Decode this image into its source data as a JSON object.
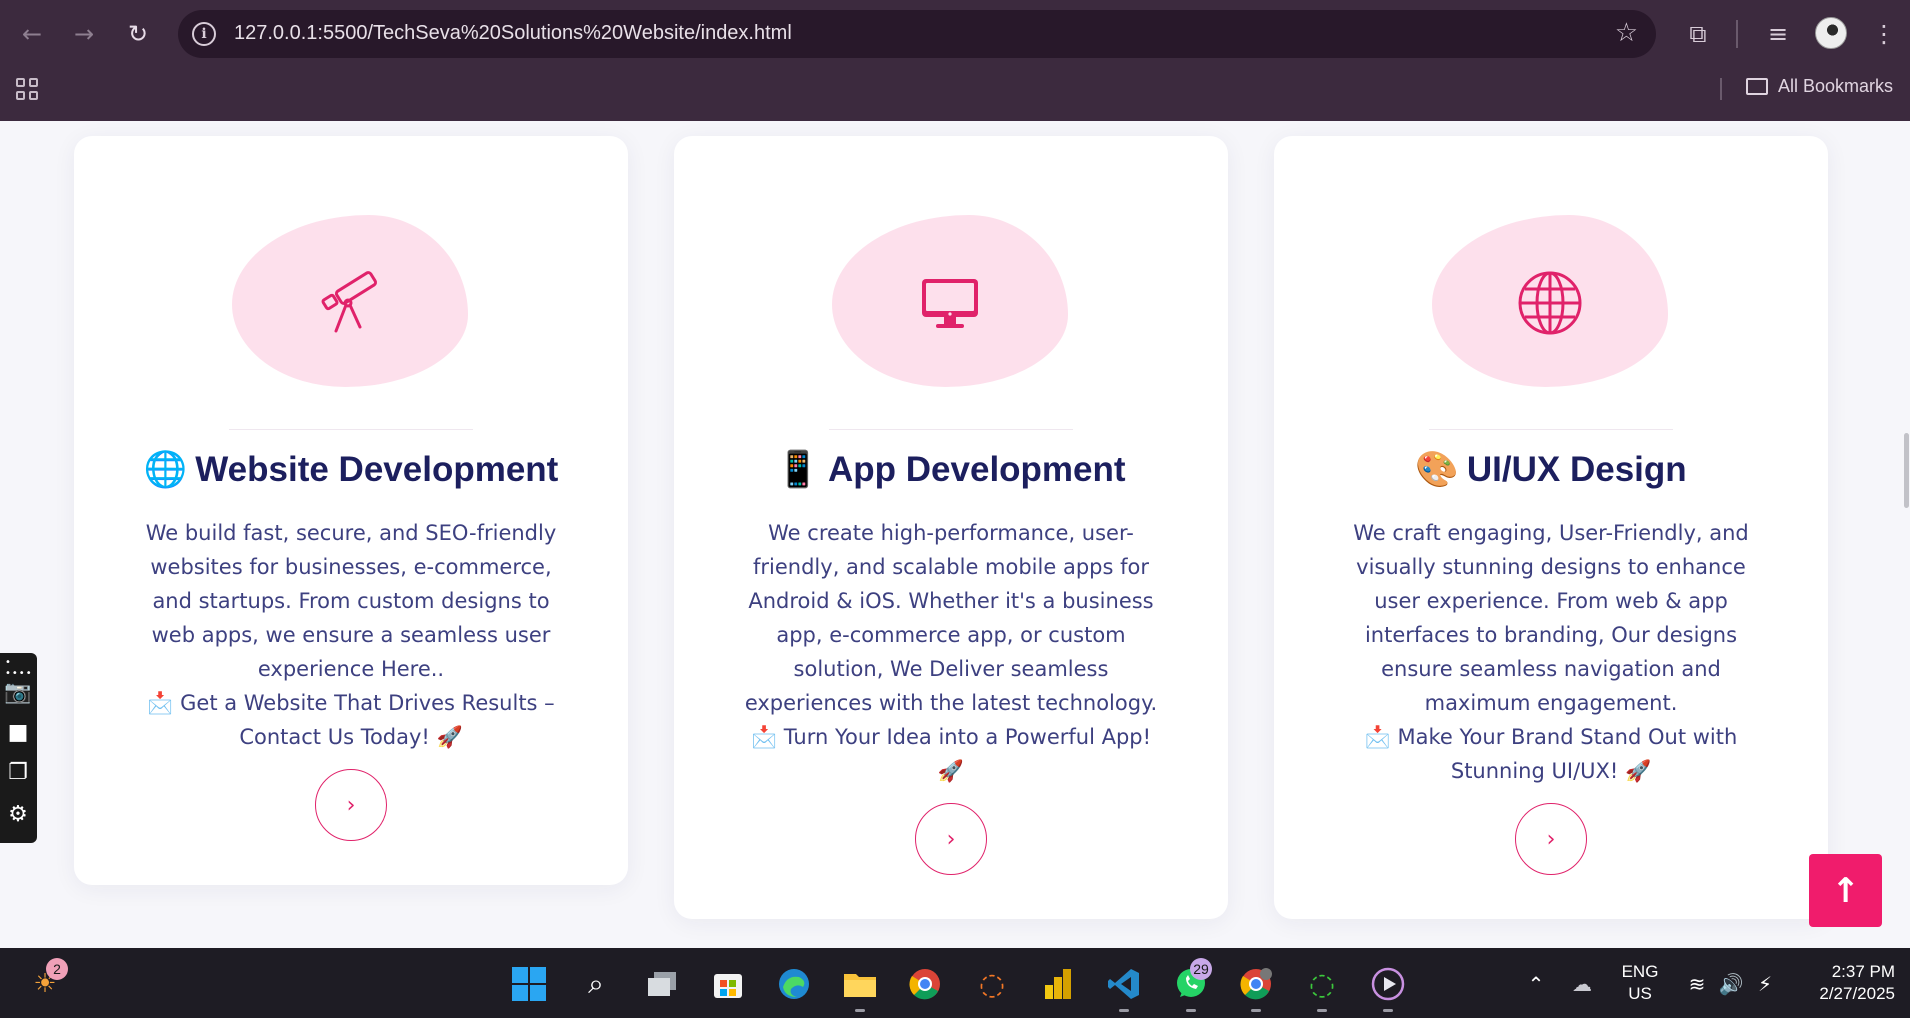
{
  "browser": {
    "url": "127.0.0.1:5500/TechSeva%20Solutions%20Website/index.html",
    "bookmarks_label": "All Bookmarks"
  },
  "cards": [
    {
      "emoji": "🌐",
      "title": "Website Development",
      "icon": "telescope-icon",
      "description": [
        "We build fast, secure, and SEO-friendly",
        "websites for businesses, e-commerce,",
        "and startups. From custom designs to",
        "web apps, we ensure a seamless user",
        "experience Here.."
      ],
      "cta": [
        "📩 Get a Website That Drives Results –",
        "Contact Us Today! 🚀"
      ]
    },
    {
      "emoji": "📱",
      "title": "App Development",
      "icon": "monitor-icon",
      "description": [
        "We create high-performance, user-",
        "friendly, and scalable mobile apps for",
        "Android & iOS. Whether it's a business",
        "app, e-commerce app, or custom",
        "solution, We Deliver seamless",
        "experiences with the latest technology."
      ],
      "cta": [
        "📩 Turn Your Idea into a Powerful App!",
        "🚀"
      ]
    },
    {
      "emoji": "🎨",
      "title": "UI/UX Design",
      "icon": "globe-icon",
      "description": [
        "We craft engaging, User-Friendly, and",
        "visually stunning designs to enhance",
        "user experience. From web & app",
        "interfaces to branding, Our designs",
        "ensure seamless navigation and",
        "maximum engagement."
      ],
      "cta": [
        "📩 Make Your Brand Stand Out with",
        "Stunning UI/UX! 🚀"
      ]
    }
  ],
  "colors": {
    "accent": "#e0226a",
    "title": "#1c1f5e",
    "text": "#3d4080",
    "blob": "#fde0ec"
  },
  "taskbar": {
    "weather_badge": "2",
    "whatsapp_badge": "29",
    "lang_line1": "ENG",
    "lang_line2": "US",
    "time": "2:37 PM",
    "date": "2/27/2025"
  }
}
